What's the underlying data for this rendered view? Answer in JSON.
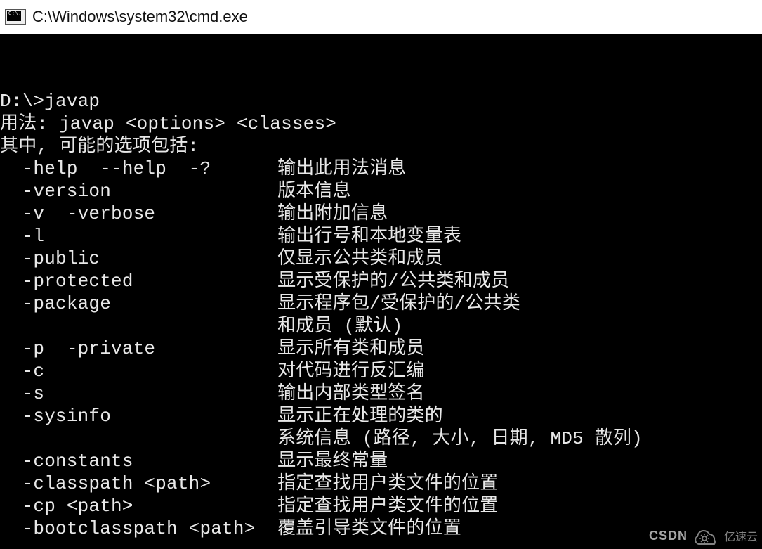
{
  "window": {
    "title": "C:\\Windows\\system32\\cmd.exe",
    "icon_name": "cmd-icon",
    "icon_glyph": "C:\\."
  },
  "terminal": {
    "prompt": "D:\\>",
    "command": "javap",
    "usage_label": "用法: javap <options> <classes>",
    "options_intro": "其中, 可能的选项包括:",
    "options": [
      {
        "flag": "-help  --help  -?",
        "desc": "输出此用法消息"
      },
      {
        "flag": "-version",
        "desc": "版本信息"
      },
      {
        "flag": "-v  -verbose",
        "desc": "输出附加信息"
      },
      {
        "flag": "-l",
        "desc": "输出行号和本地变量表"
      },
      {
        "flag": "-public",
        "desc": "仅显示公共类和成员"
      },
      {
        "flag": "-protected",
        "desc": "显示受保护的/公共类和成员"
      },
      {
        "flag": "-package",
        "desc": "显示程序包/受保护的/公共类"
      },
      {
        "flag": "",
        "desc": "和成员 (默认)"
      },
      {
        "flag": "-p  -private",
        "desc": "显示所有类和成员"
      },
      {
        "flag": "-c",
        "desc": "对代码进行反汇编"
      },
      {
        "flag": "-s",
        "desc": "输出内部类型签名"
      },
      {
        "flag": "-sysinfo",
        "desc": "显示正在处理的类的"
      },
      {
        "flag": "",
        "desc": "系统信息 (路径, 大小, 日期, MD5 散列)"
      },
      {
        "flag": "-constants",
        "desc": "显示最终常量"
      },
      {
        "flag": "-classpath <path>",
        "desc": "指定查找用户类文件的位置"
      },
      {
        "flag": "-cp <path>",
        "desc": "指定查找用户类文件的位置"
      },
      {
        "flag": "-bootclasspath <path>",
        "desc": "覆盖引导类文件的位置"
      }
    ]
  },
  "watermark": {
    "left": "CSDN",
    "brand": "亿速云"
  }
}
